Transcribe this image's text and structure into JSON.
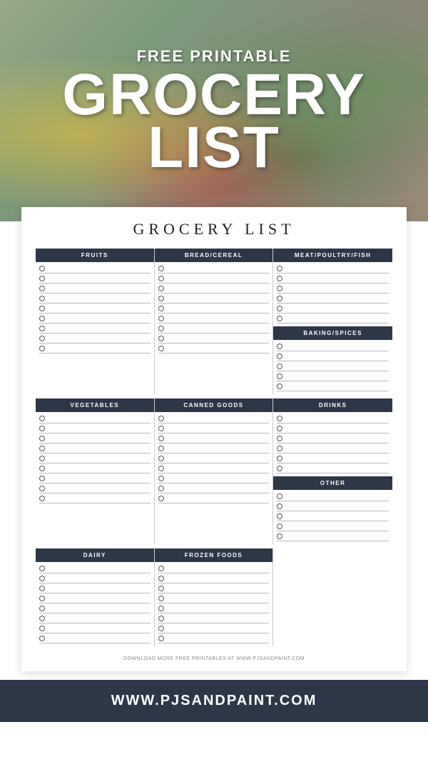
{
  "hero": {
    "free_printable": "FREE PRINTABLE",
    "grocery": "GROCERY",
    "list": "LIST"
  },
  "card": {
    "title": "GROCERY LIST",
    "footer": "DOWNLOAD MORE FREE PRINTABLES AT WWW.PJSANDPAINT.COM"
  },
  "sections": {
    "fruits": "FRUITS",
    "bread_cereal": "BREAD/CEREAL",
    "meat": "MEAT/POULTRY/FISH",
    "vegetables": "VEGETABLES",
    "canned_goods": "CANNED GOODS",
    "baking": "BAKING/SPICES",
    "dairy": "DAIRY",
    "frozen": "FROZEN FOODS",
    "drinks": "DRINKS",
    "other": "OTHER"
  },
  "rows": {
    "fruits_count": 9,
    "bread_count": 9,
    "meat_count": 6,
    "vegetables_count": 9,
    "canned_count": 9,
    "baking_count": 5,
    "dairy_count": 8,
    "frozen_count": 8,
    "drinks_count": 6,
    "other_count": 5
  },
  "bottom_bar": {
    "url": "WWW.PJSANDPAINT.COM"
  }
}
